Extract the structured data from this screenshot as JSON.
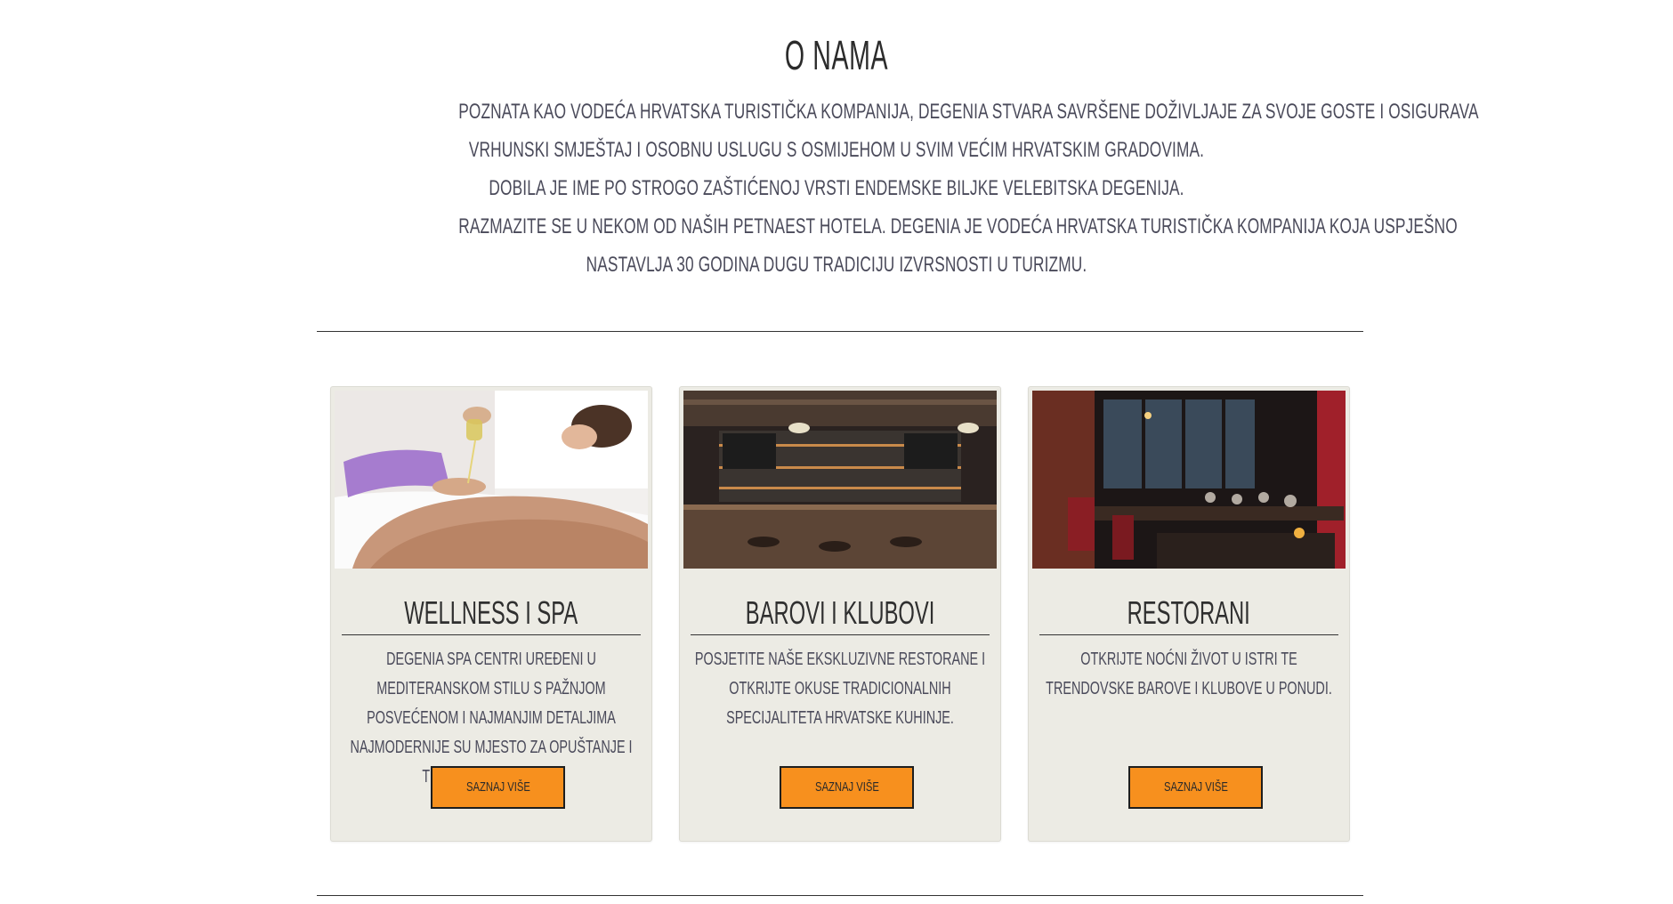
{
  "about": {
    "title": "O NAMA",
    "lines": [
      "Poznata kao vodeća hrvatska turistička kompanija, Degenia stvara savršene doživljaje za svoje goste i osigurava",
      "vrhunski smještaj i osobnu uslugu s osmijehom u svim većim hrvatskim gradovima.",
      "Dobila je ime po strogo zaštićenoj vrsti endemske biljke velebitska degenija.",
      "Razmazite se u nekom od naših petnaest hotela. Degenia je vodeća hrvatska turistička kompanija koja uspješno",
      "nastavlja 30 godina dugu tradiciju izvrsnosti u turizmu."
    ]
  },
  "cards": [
    {
      "title": "Wellness i Spa",
      "image": "spa-massage-photo",
      "description": "Degenia Spa centri uređeni u mediteranskom stilu s pažnjom posvećenom i najmanjim detaljima najmodernije su mjesto za opuštanje i tretmane ljepote.!",
      "button": "Saznaj više"
    },
    {
      "title": "Barovi i klubovi",
      "image": "bar-interior-photo",
      "description": "Posjetite naše ekskluzivne restorane i otkrijte okuse tradicionalnih specijaliteta hrvatske kuhinje.",
      "button": "Saznaj više"
    },
    {
      "title": "Restorani",
      "image": "restaurant-interior-photo",
      "description": "Otkrijte noćni život u Istri te trendovske barove i klubove u ponudi.",
      "button": "Saznaj više"
    }
  ],
  "colors": {
    "button": "#f7901e",
    "card_bg": "#ecebe4",
    "text": "#4a4a5a"
  }
}
